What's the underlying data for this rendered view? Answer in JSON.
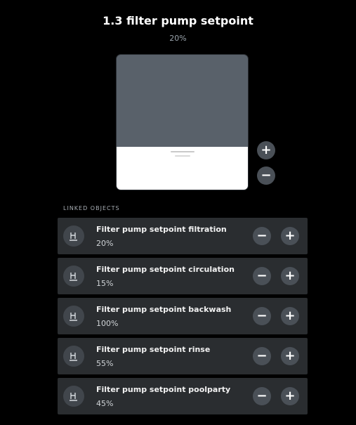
{
  "header": {
    "title": "1.3 filter pump setpoint",
    "value": "20%"
  },
  "slider": {
    "level_fraction": 0.32,
    "plus_label": "+",
    "minus_label": "−"
  },
  "linked": {
    "section_label": "LINKED OBJECTS",
    "items": [
      {
        "title": "Filter pump setpoint filtration",
        "value": "20%",
        "minus_label": "−",
        "plus_label": "+"
      },
      {
        "title": "Filter pump setpoint circulation",
        "value": "15%",
        "minus_label": "−",
        "plus_label": "+"
      },
      {
        "title": "Filter pump setpoint backwash",
        "value": "100%",
        "minus_label": "−",
        "plus_label": "+"
      },
      {
        "title": "Filter pump setpoint rinse",
        "value": "55%",
        "minus_label": "−",
        "plus_label": "+"
      },
      {
        "title": "Filter pump setpoint poolparty",
        "value": "45%",
        "minus_label": "−",
        "plus_label": "+"
      }
    ],
    "icon": "pump-icon"
  },
  "colors": {
    "background": "#000000",
    "slider_track": "#59616a",
    "slider_fill": "#ffffff",
    "card": "#2a2d30",
    "button": "#4a5057"
  }
}
